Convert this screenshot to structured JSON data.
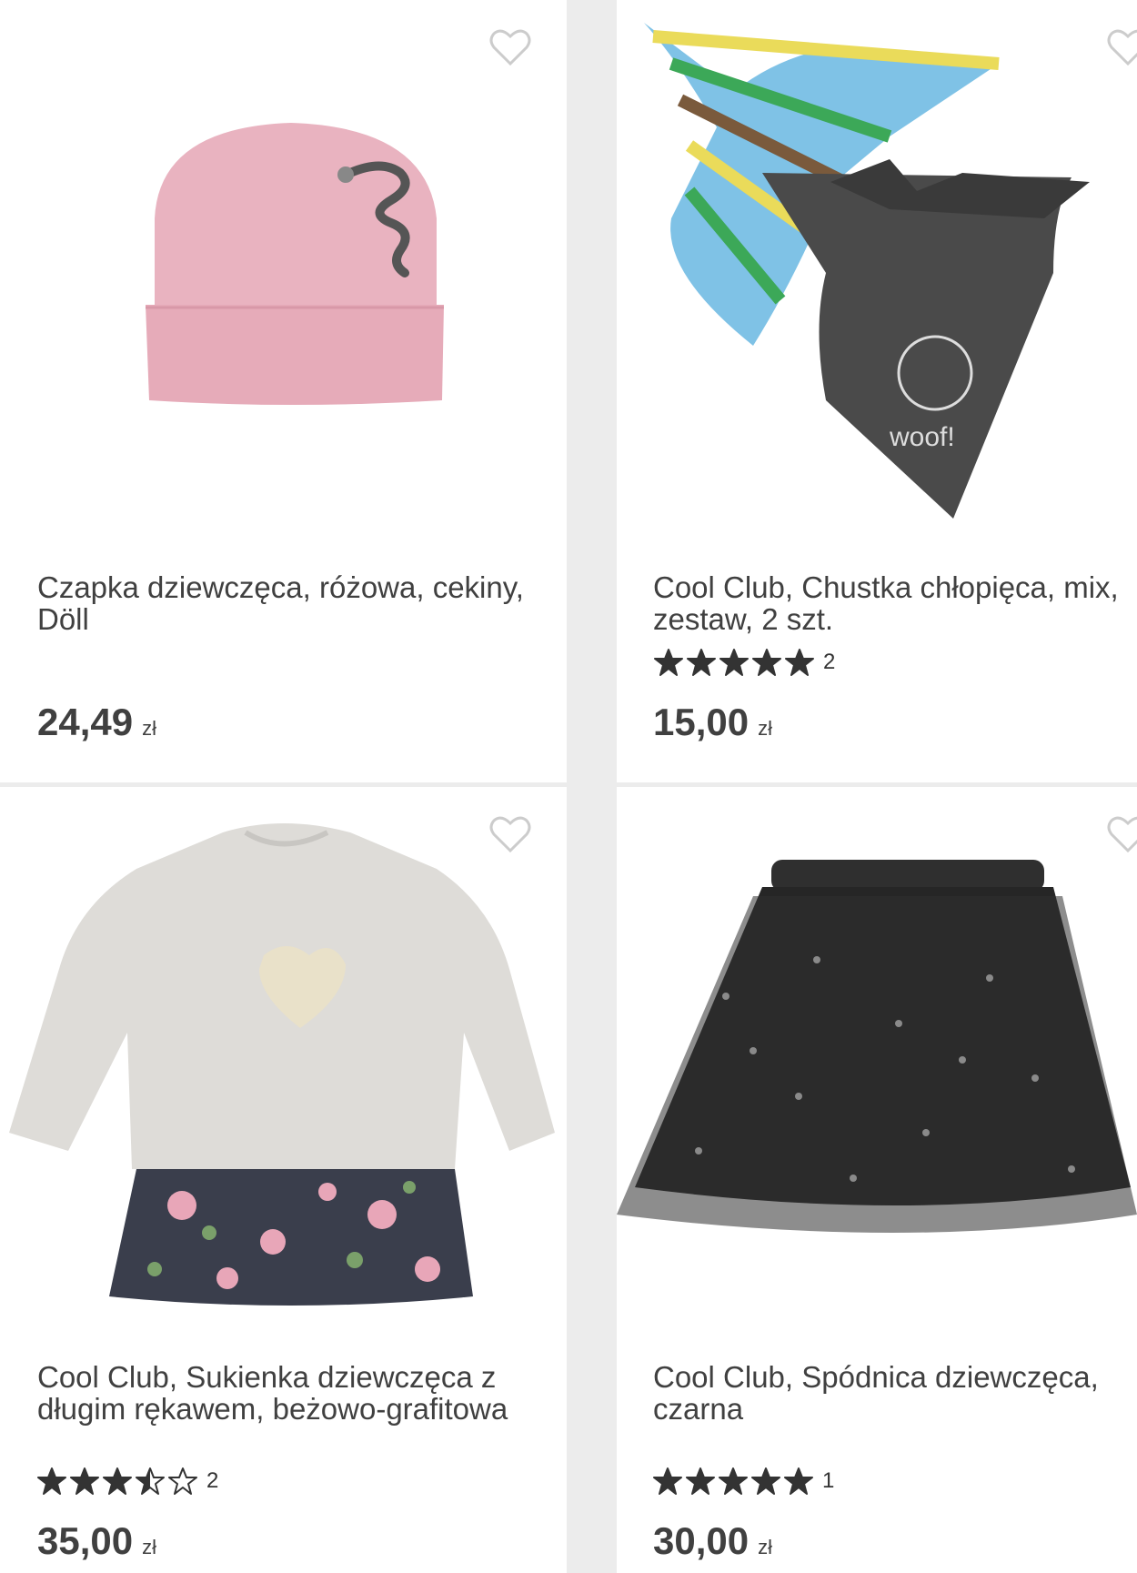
{
  "products": [
    {
      "title": "Czapka dziewczęca, różowa, cekiny, Döll",
      "price": "24,49",
      "currency": "zł",
      "rating": null,
      "review_count": null,
      "image": "pink-beanie-sequin"
    },
    {
      "title": "Cool Club, Chustka chłopięca, mix, zestaw, 2 szt.",
      "price": "15,00",
      "currency": "zł",
      "rating": 5,
      "review_count": "2",
      "image": "striped-and-dog-bandanas"
    },
    {
      "title": "Cool Club, Sukienka dziewczęca z długim rękawem, beżowo-grafitowa",
      "price": "35,00",
      "currency": "zł",
      "rating": 3.5,
      "review_count": "2",
      "image": "grey-sweatshirt-floral-dress"
    },
    {
      "title": "Cool Club, Spódnica dziewczęca, czarna",
      "price": "30,00",
      "currency": "zł",
      "rating": 5,
      "review_count": "1",
      "image": "black-tulle-star-skirt"
    }
  ],
  "colors": {
    "star": "#333333",
    "heart_outline": "#cccccc",
    "card_bg": "#ffffff",
    "page_bg": "#ececec"
  }
}
